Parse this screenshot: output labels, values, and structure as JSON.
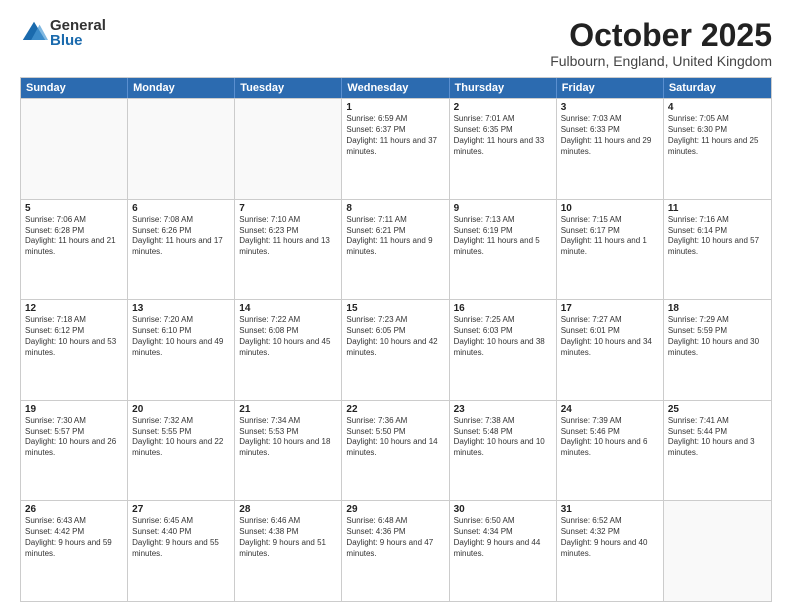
{
  "logo": {
    "general": "General",
    "blue": "Blue"
  },
  "header": {
    "month": "October 2025",
    "location": "Fulbourn, England, United Kingdom"
  },
  "days": [
    "Sunday",
    "Monday",
    "Tuesday",
    "Wednesday",
    "Thursday",
    "Friday",
    "Saturday"
  ],
  "rows": [
    [
      {
        "day": "",
        "empty": true
      },
      {
        "day": "",
        "empty": true
      },
      {
        "day": "",
        "empty": true
      },
      {
        "day": "1",
        "sunrise": "Sunrise: 6:59 AM",
        "sunset": "Sunset: 6:37 PM",
        "daylight": "Daylight: 11 hours and 37 minutes."
      },
      {
        "day": "2",
        "sunrise": "Sunrise: 7:01 AM",
        "sunset": "Sunset: 6:35 PM",
        "daylight": "Daylight: 11 hours and 33 minutes."
      },
      {
        "day": "3",
        "sunrise": "Sunrise: 7:03 AM",
        "sunset": "Sunset: 6:33 PM",
        "daylight": "Daylight: 11 hours and 29 minutes."
      },
      {
        "day": "4",
        "sunrise": "Sunrise: 7:05 AM",
        "sunset": "Sunset: 6:30 PM",
        "daylight": "Daylight: 11 hours and 25 minutes."
      }
    ],
    [
      {
        "day": "5",
        "sunrise": "Sunrise: 7:06 AM",
        "sunset": "Sunset: 6:28 PM",
        "daylight": "Daylight: 11 hours and 21 minutes."
      },
      {
        "day": "6",
        "sunrise": "Sunrise: 7:08 AM",
        "sunset": "Sunset: 6:26 PM",
        "daylight": "Daylight: 11 hours and 17 minutes."
      },
      {
        "day": "7",
        "sunrise": "Sunrise: 7:10 AM",
        "sunset": "Sunset: 6:23 PM",
        "daylight": "Daylight: 11 hours and 13 minutes."
      },
      {
        "day": "8",
        "sunrise": "Sunrise: 7:11 AM",
        "sunset": "Sunset: 6:21 PM",
        "daylight": "Daylight: 11 hours and 9 minutes."
      },
      {
        "day": "9",
        "sunrise": "Sunrise: 7:13 AM",
        "sunset": "Sunset: 6:19 PM",
        "daylight": "Daylight: 11 hours and 5 minutes."
      },
      {
        "day": "10",
        "sunrise": "Sunrise: 7:15 AM",
        "sunset": "Sunset: 6:17 PM",
        "daylight": "Daylight: 11 hours and 1 minute."
      },
      {
        "day": "11",
        "sunrise": "Sunrise: 7:16 AM",
        "sunset": "Sunset: 6:14 PM",
        "daylight": "Daylight: 10 hours and 57 minutes."
      }
    ],
    [
      {
        "day": "12",
        "sunrise": "Sunrise: 7:18 AM",
        "sunset": "Sunset: 6:12 PM",
        "daylight": "Daylight: 10 hours and 53 minutes."
      },
      {
        "day": "13",
        "sunrise": "Sunrise: 7:20 AM",
        "sunset": "Sunset: 6:10 PM",
        "daylight": "Daylight: 10 hours and 49 minutes."
      },
      {
        "day": "14",
        "sunrise": "Sunrise: 7:22 AM",
        "sunset": "Sunset: 6:08 PM",
        "daylight": "Daylight: 10 hours and 45 minutes."
      },
      {
        "day": "15",
        "sunrise": "Sunrise: 7:23 AM",
        "sunset": "Sunset: 6:05 PM",
        "daylight": "Daylight: 10 hours and 42 minutes."
      },
      {
        "day": "16",
        "sunrise": "Sunrise: 7:25 AM",
        "sunset": "Sunset: 6:03 PM",
        "daylight": "Daylight: 10 hours and 38 minutes."
      },
      {
        "day": "17",
        "sunrise": "Sunrise: 7:27 AM",
        "sunset": "Sunset: 6:01 PM",
        "daylight": "Daylight: 10 hours and 34 minutes."
      },
      {
        "day": "18",
        "sunrise": "Sunrise: 7:29 AM",
        "sunset": "Sunset: 5:59 PM",
        "daylight": "Daylight: 10 hours and 30 minutes."
      }
    ],
    [
      {
        "day": "19",
        "sunrise": "Sunrise: 7:30 AM",
        "sunset": "Sunset: 5:57 PM",
        "daylight": "Daylight: 10 hours and 26 minutes."
      },
      {
        "day": "20",
        "sunrise": "Sunrise: 7:32 AM",
        "sunset": "Sunset: 5:55 PM",
        "daylight": "Daylight: 10 hours and 22 minutes."
      },
      {
        "day": "21",
        "sunrise": "Sunrise: 7:34 AM",
        "sunset": "Sunset: 5:53 PM",
        "daylight": "Daylight: 10 hours and 18 minutes."
      },
      {
        "day": "22",
        "sunrise": "Sunrise: 7:36 AM",
        "sunset": "Sunset: 5:50 PM",
        "daylight": "Daylight: 10 hours and 14 minutes."
      },
      {
        "day": "23",
        "sunrise": "Sunrise: 7:38 AM",
        "sunset": "Sunset: 5:48 PM",
        "daylight": "Daylight: 10 hours and 10 minutes."
      },
      {
        "day": "24",
        "sunrise": "Sunrise: 7:39 AM",
        "sunset": "Sunset: 5:46 PM",
        "daylight": "Daylight: 10 hours and 6 minutes."
      },
      {
        "day": "25",
        "sunrise": "Sunrise: 7:41 AM",
        "sunset": "Sunset: 5:44 PM",
        "daylight": "Daylight: 10 hours and 3 minutes."
      }
    ],
    [
      {
        "day": "26",
        "sunrise": "Sunrise: 6:43 AM",
        "sunset": "Sunset: 4:42 PM",
        "daylight": "Daylight: 9 hours and 59 minutes."
      },
      {
        "day": "27",
        "sunrise": "Sunrise: 6:45 AM",
        "sunset": "Sunset: 4:40 PM",
        "daylight": "Daylight: 9 hours and 55 minutes."
      },
      {
        "day": "28",
        "sunrise": "Sunrise: 6:46 AM",
        "sunset": "Sunset: 4:38 PM",
        "daylight": "Daylight: 9 hours and 51 minutes."
      },
      {
        "day": "29",
        "sunrise": "Sunrise: 6:48 AM",
        "sunset": "Sunset: 4:36 PM",
        "daylight": "Daylight: 9 hours and 47 minutes."
      },
      {
        "day": "30",
        "sunrise": "Sunrise: 6:50 AM",
        "sunset": "Sunset: 4:34 PM",
        "daylight": "Daylight: 9 hours and 44 minutes."
      },
      {
        "day": "31",
        "sunrise": "Sunrise: 6:52 AM",
        "sunset": "Sunset: 4:32 PM",
        "daylight": "Daylight: 9 hours and 40 minutes."
      },
      {
        "day": "",
        "empty": true
      }
    ]
  ]
}
